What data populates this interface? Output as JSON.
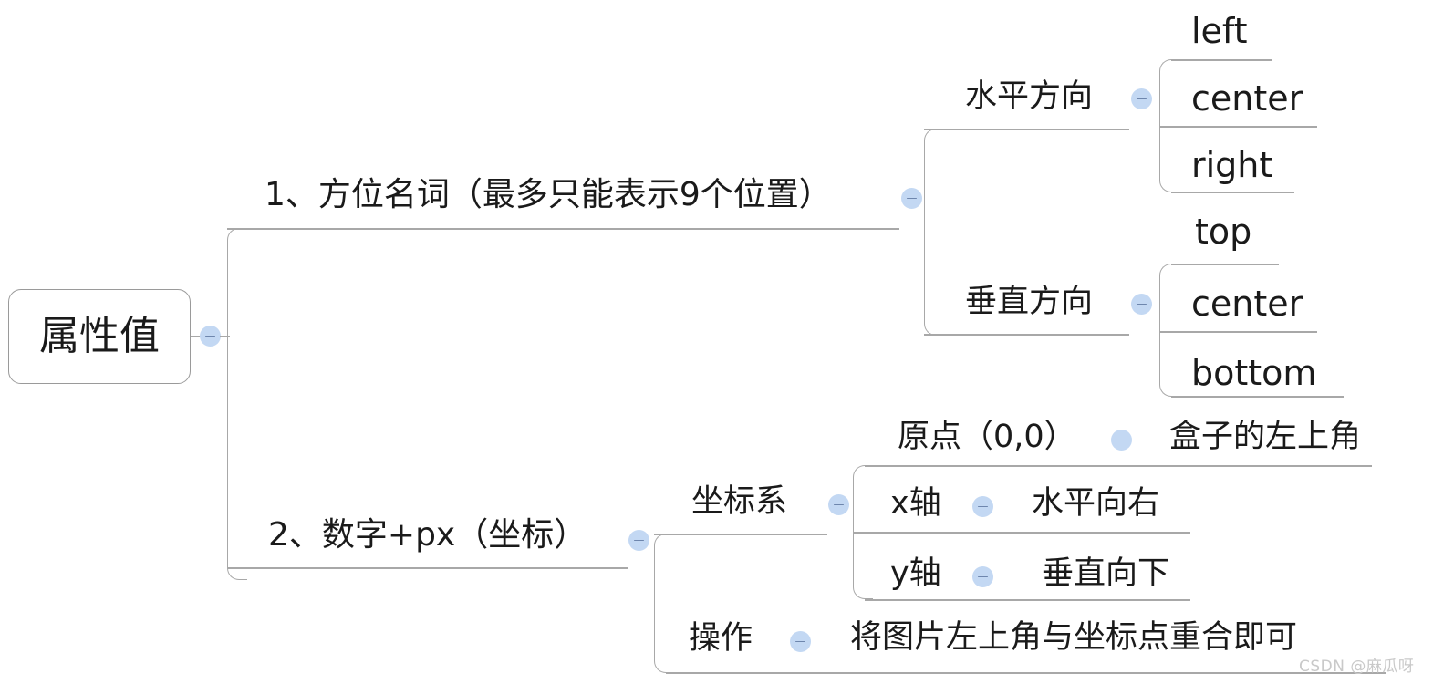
{
  "diagram": {
    "type": "mind-map",
    "title": "属性值",
    "root": {
      "label": "属性值",
      "collapse_icon": "minus-circle-icon"
    },
    "branches": [
      {
        "id": "b1",
        "label": "1、方位名词（最多只能表示9个位置）",
        "collapse_icon": "minus-circle-icon",
        "children": [
          {
            "id": "b1c1",
            "label": "水平方向",
            "collapse_icon": "minus-circle-icon",
            "children": [
              {
                "id": "b1c1g1",
                "label": "left"
              },
              {
                "id": "b1c1g2",
                "label": "center"
              },
              {
                "id": "b1c1g3",
                "label": "right"
              }
            ]
          },
          {
            "id": "b1c2",
            "label": "垂直方向",
            "collapse_icon": "minus-circle-icon",
            "children": [
              {
                "id": "b1c2g1",
                "label": "top"
              },
              {
                "id": "b1c2g2",
                "label": "center"
              },
              {
                "id": "b1c2g3",
                "label": "bottom"
              }
            ]
          }
        ]
      },
      {
        "id": "b2",
        "label": "2、数字+px（坐标）",
        "collapse_icon": "minus-circle-icon",
        "children": [
          {
            "id": "b2c1",
            "label": "坐标系",
            "collapse_icon": "minus-circle-icon",
            "children": [
              {
                "id": "b2c1g1",
                "label": "原点（0,0）",
                "collapse_icon": "minus-circle-icon",
                "value": "盒子的左上角"
              },
              {
                "id": "b2c1g2",
                "label": "x轴",
                "collapse_icon": "minus-circle-icon",
                "value": "水平向右"
              },
              {
                "id": "b2c1g3",
                "label": "y轴",
                "collapse_icon": "minus-circle-icon",
                "value": "垂直向下"
              }
            ]
          },
          {
            "id": "b2c2",
            "label": "操作",
            "collapse_icon": "minus-circle-icon",
            "value": "将图片左上角与坐标点重合即可"
          }
        ]
      }
    ],
    "colors": {
      "line": "#a8a8a8",
      "circle_fill": "#c3d8f3",
      "circle_mark": "#6e86ad",
      "text": "#1a1a1a",
      "watermark": "#c9c9c9",
      "background": "#ffffff"
    }
  },
  "watermark": {
    "text": "CSDN @麻瓜呀"
  }
}
